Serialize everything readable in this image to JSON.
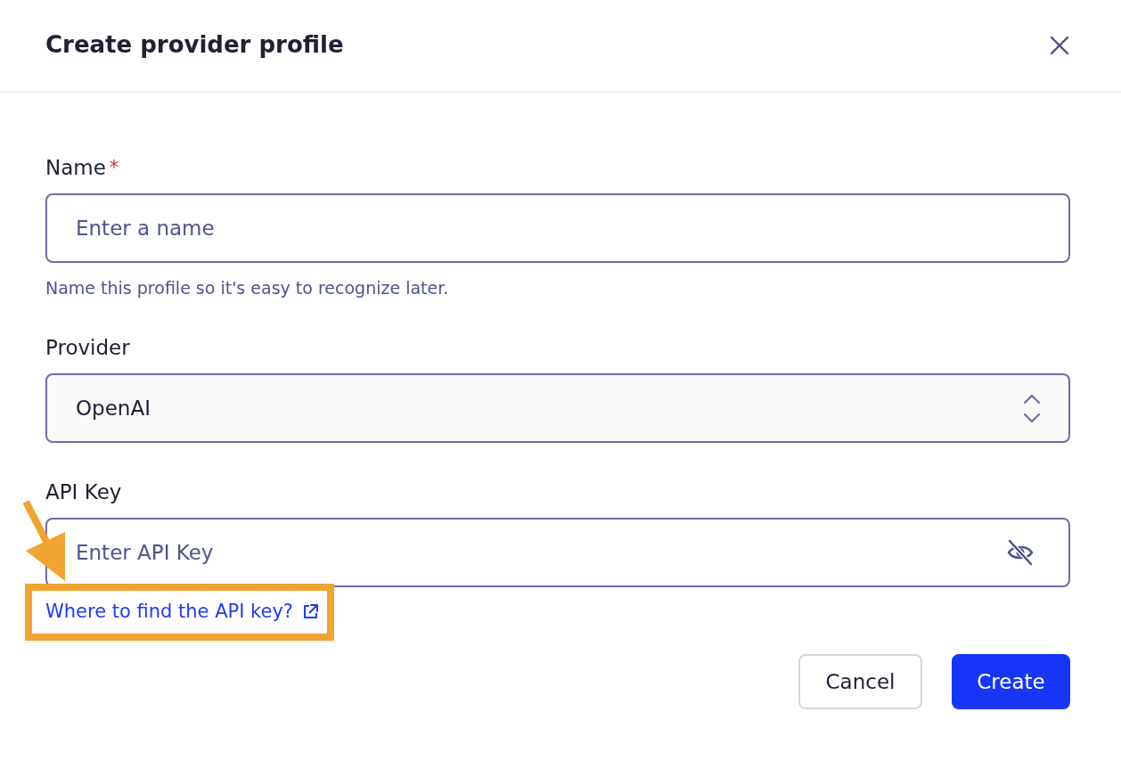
{
  "dialog": {
    "title": "Create provider profile"
  },
  "fields": [
    {
      "kind": "text",
      "label": "Name",
      "required_mark": "*",
      "placeholder": "Enter a name",
      "help": "Name this profile so it's easy to recognize later."
    },
    {
      "kind": "select",
      "label": "Provider",
      "value": "OpenAI"
    },
    {
      "kind": "secret",
      "label": "API Key",
      "placeholder": "Enter API Key",
      "revealed": false,
      "link": {
        "text": "Where to find the API key?",
        "highlighted": true
      }
    }
  ],
  "buttons": [
    {
      "kind": "secondary",
      "label": "Cancel"
    },
    {
      "kind": "primary",
      "label": "Create"
    }
  ]
}
